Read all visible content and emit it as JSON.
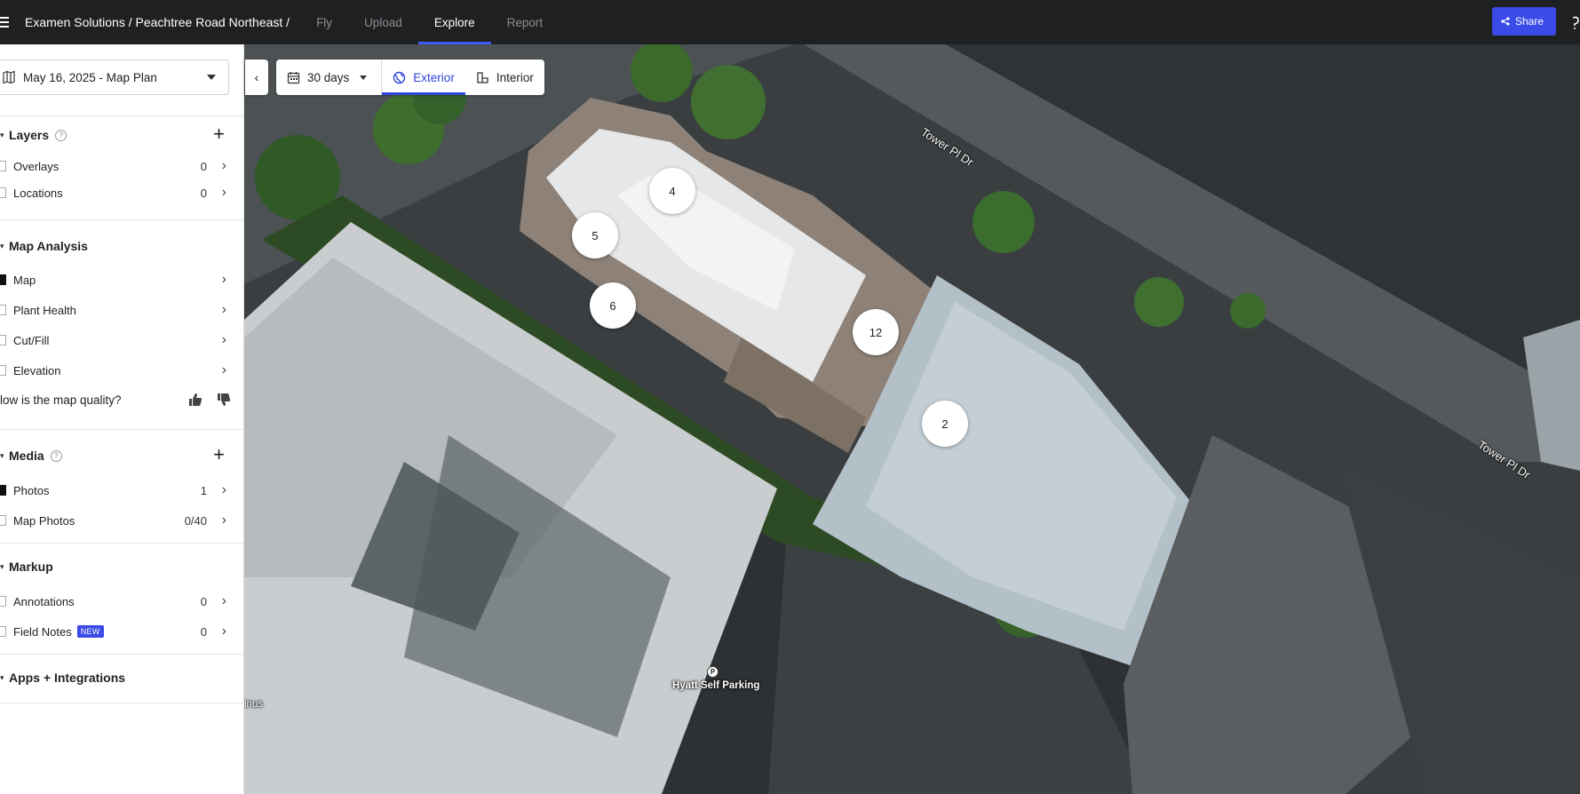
{
  "header": {
    "breadcrumb": "Examen Solutions / Peachtree Road Northeast /",
    "tabs": [
      {
        "label": "Fly",
        "active": false
      },
      {
        "label": "Upload",
        "active": false
      },
      {
        "label": "Explore",
        "active": true
      },
      {
        "label": "Report",
        "active": false
      }
    ],
    "share_label": "Share"
  },
  "sidebar": {
    "plan_select": "May 16, 2025 - Map Plan",
    "layers": {
      "title": "Layers",
      "items": [
        {
          "label": "Overlays",
          "count": "0",
          "checked": false
        },
        {
          "label": "Locations",
          "count": "0",
          "checked": false
        }
      ]
    },
    "map_analysis": {
      "title": "Map Analysis",
      "items": [
        {
          "label": "Map",
          "checked": true
        },
        {
          "label": "Plant Health",
          "checked": false
        },
        {
          "label": "Cut/Fill",
          "checked": false
        },
        {
          "label": "Elevation",
          "checked": false
        }
      ],
      "quality_prompt": "low is the map quality?"
    },
    "media": {
      "title": "Media",
      "items": [
        {
          "label": "Photos",
          "count": "1",
          "checked": true
        },
        {
          "label": "Map Photos",
          "count": "0/40",
          "checked": false
        }
      ]
    },
    "markup": {
      "title": "Markup",
      "items": [
        {
          "label": "Annotations",
          "count": "0",
          "checked": false
        },
        {
          "label": "Field Notes",
          "badge": "NEW",
          "count": "0",
          "checked": false
        }
      ]
    },
    "apps": {
      "title": "Apps + Integrations"
    }
  },
  "map": {
    "toolbar": {
      "days": "30 days",
      "exterior": "Exterior",
      "interior": "Interior",
      "active_view": "Exterior"
    },
    "markers": [
      "4",
      "5",
      "6",
      "12",
      "2"
    ],
    "labels": {
      "road_1": "Tower Pl Dr",
      "road_2": "Tower Pl Dr",
      "poi": "Hyatt Self Parking",
      "poi_pin": "P",
      "edge_text": "inus"
    }
  },
  "colors": {
    "accent": "#3a4be8",
    "topbar": "#1f2022"
  }
}
